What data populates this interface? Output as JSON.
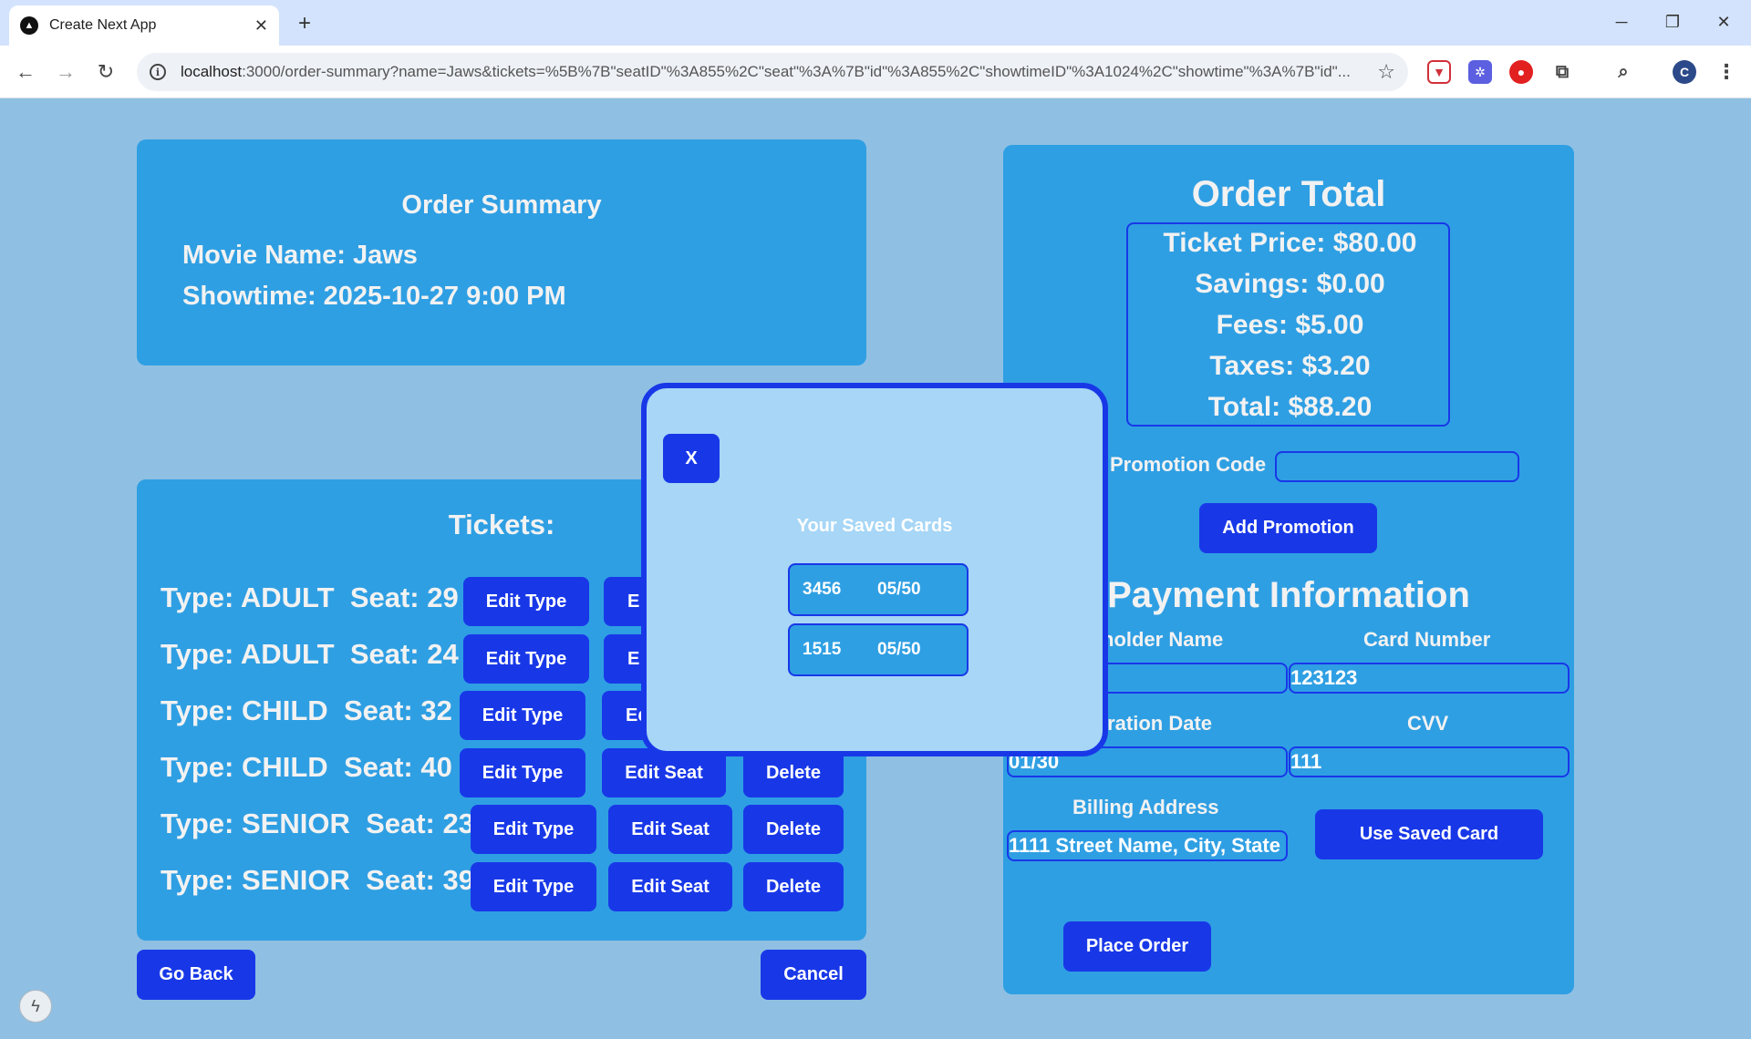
{
  "browser": {
    "tab_title": "Create Next App",
    "url_host": "localhost",
    "url_rest": ":3000/order-summary?name=Jaws&tickets=%5B%7B\"seatID\"%3A855%2C\"seat\"%3A%7B\"id\"%3A855%2C\"showtimeID\"%3A1024%2C\"showtime\"%3A%7B\"id\"..."
  },
  "summary": {
    "title": "Order Summary",
    "movie_line": "Movie Name: Jaws",
    "showtime_line": "Showtime: 2025-10-27 9:00 PM"
  },
  "tickets": {
    "title": "Tickets:",
    "edit_type_label": "Edit Type",
    "edit_seat_label": "Edit Seat",
    "delete_label": "Delete",
    "rows": [
      {
        "type": "Type: ADULT",
        "seat": "Seat: 29"
      },
      {
        "type": "Type: ADULT",
        "seat": "Seat: 24"
      },
      {
        "type": "Type: CHILD",
        "seat": "Seat: 32"
      },
      {
        "type": "Type: CHILD",
        "seat": "Seat: 40"
      },
      {
        "type": "Type: SENIOR",
        "seat": "Seat: 23"
      },
      {
        "type": "Type: SENIOR",
        "seat": "Seat: 39"
      }
    ],
    "partial_edit_seat": [
      "E",
      "E",
      "Ed"
    ]
  },
  "actions": {
    "go_back": "Go Back",
    "cancel": "Cancel"
  },
  "total": {
    "title": "Order Total",
    "ticket_price": "Ticket Price: $80.00",
    "savings": "Savings: $0.00",
    "fees": "Fees: $5.00",
    "taxes": "Taxes: $3.20",
    "total": "Total: $88.20",
    "promo_label": "Promotion Code",
    "promo_value": "",
    "add_promotion": "Add Promotion"
  },
  "payment": {
    "title": "Payment Information",
    "holder_label": "holder Name",
    "holder_value": "",
    "card_number_label": "Card Number",
    "card_number_value": "123123",
    "expiration_label": "iration Date",
    "expiration_value": "01/30",
    "cvv_label": "CVV",
    "cvv_value": "111",
    "billing_label": "Billing Address",
    "billing_value": "1111 Street Name, City, State",
    "use_saved_card": "Use Saved Card",
    "place_order": "Place Order"
  },
  "modal": {
    "close_label": "X",
    "title": "Your Saved Cards",
    "cards": [
      {
        "number": "3456",
        "expiry": "05/50"
      },
      {
        "number": "1515",
        "expiry": "05/50"
      }
    ]
  },
  "colors": {
    "background": "#8fc0e3",
    "panel": "#2f9fe3",
    "button": "#1838e8",
    "modal_bg": "#a7d6f6"
  }
}
